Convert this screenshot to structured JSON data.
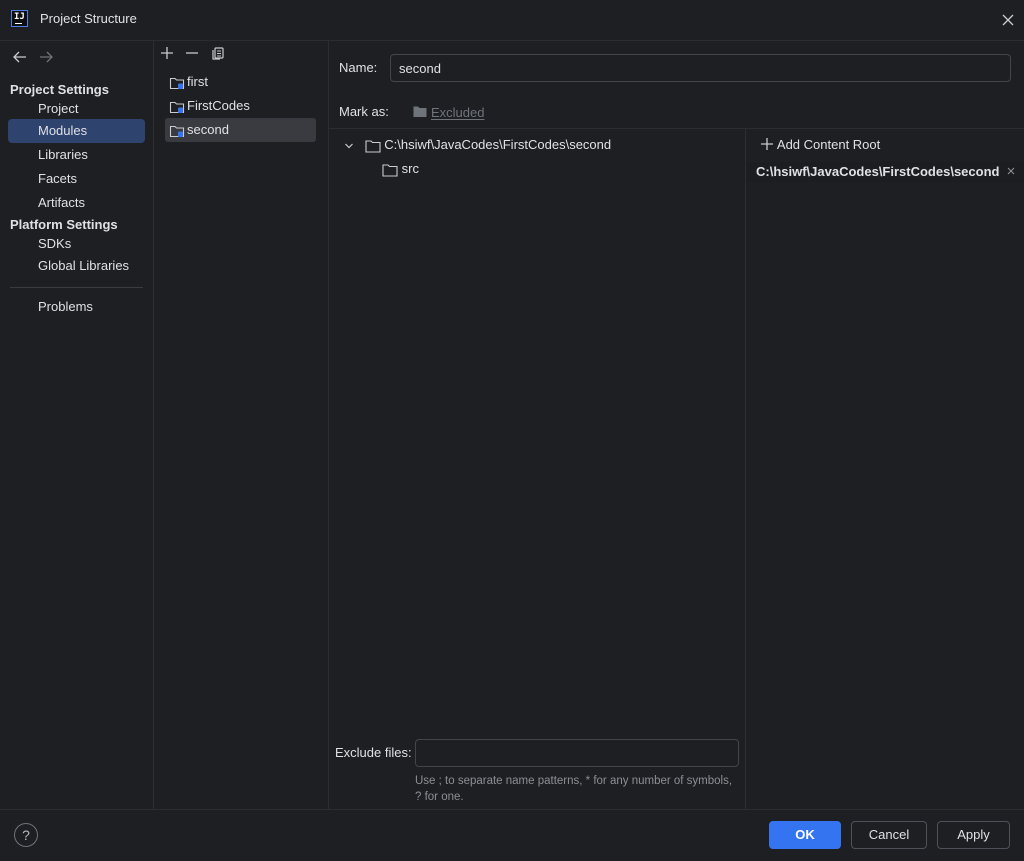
{
  "window": {
    "title": "Project Structure"
  },
  "sidebar": {
    "project_settings_heading": "Project Settings",
    "platform_settings_heading": "Platform Settings",
    "items": [
      {
        "label": "Project"
      },
      {
        "label": "Modules",
        "selected": true
      },
      {
        "label": "Libraries"
      },
      {
        "label": "Facets"
      },
      {
        "label": "Artifacts"
      },
      {
        "label": "SDKs"
      },
      {
        "label": "Global Libraries"
      },
      {
        "label": "Problems"
      }
    ]
  },
  "modules": {
    "toolbar_icons": [
      "add-icon",
      "remove-icon",
      "copy-icon"
    ],
    "items": [
      {
        "label": "first"
      },
      {
        "label": "FirstCodes"
      },
      {
        "label": "second",
        "selected": true
      }
    ]
  },
  "main": {
    "name_label": "Name:",
    "name_value": "second",
    "mark_as_label": "Mark as:",
    "excluded_label": "Excluded",
    "tree": {
      "root": "C:\\hsiwf\\JavaCodes\\FirstCodes\\second",
      "children": [
        "src"
      ]
    },
    "add_content_root_label": "Add Content Root",
    "content_root_path": "C:\\hsiwf\\JavaCodes\\FirstCodes\\second",
    "exclude_files_label": "Exclude files:",
    "exclude_files_value": "",
    "exclude_hint": "Use ; to separate name patterns, * for any number of symbols, ? for one."
  },
  "footer": {
    "help_label": "?",
    "ok_label": "OK",
    "cancel_label": "Cancel",
    "apply_label": "Apply"
  },
  "colors": {
    "background": "#1e1f22",
    "selection": "#2e436e",
    "primary_button": "#3574f0",
    "text": "#dfe1e5",
    "muted_text": "#6f737a"
  }
}
